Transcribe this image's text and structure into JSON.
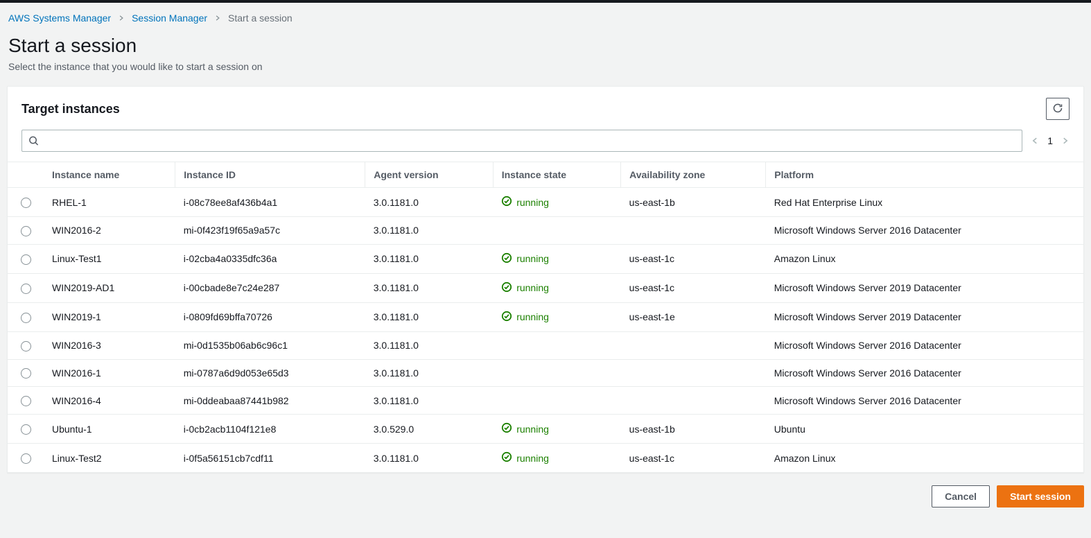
{
  "breadcrumb": {
    "items": [
      {
        "label": "AWS Systems Manager",
        "href": "#"
      },
      {
        "label": "Session Manager",
        "href": "#"
      }
    ],
    "current": "Start a session"
  },
  "header": {
    "title": "Start a session",
    "subtitle": "Select the instance that you would like to start a session on"
  },
  "panel": {
    "title": "Target instances",
    "search_placeholder": "",
    "page": "1"
  },
  "columns": {
    "instance_name": "Instance name",
    "instance_id": "Instance ID",
    "agent_version": "Agent version",
    "instance_state": "Instance state",
    "availability_zone": "Availability zone",
    "platform": "Platform"
  },
  "state_label": "running",
  "rows": [
    {
      "name": "RHEL-1",
      "id": "i-08c78ee8af436b4a1",
      "agent": "3.0.1181.0",
      "state": "running",
      "az": "us-east-1b",
      "platform": "Red Hat Enterprise Linux"
    },
    {
      "name": "WIN2016-2",
      "id": "mi-0f423f19f65a9a57c",
      "agent": "3.0.1181.0",
      "state": "",
      "az": "",
      "platform": "Microsoft Windows Server 2016 Datacenter"
    },
    {
      "name": "Linux-Test1",
      "id": "i-02cba4a0335dfc36a",
      "agent": "3.0.1181.0",
      "state": "running",
      "az": "us-east-1c",
      "platform": "Amazon Linux"
    },
    {
      "name": "WIN2019-AD1",
      "id": "i-00cbade8e7c24e287",
      "agent": "3.0.1181.0",
      "state": "running",
      "az": "us-east-1c",
      "platform": "Microsoft Windows Server 2019 Datacenter"
    },
    {
      "name": "WIN2019-1",
      "id": "i-0809fd69bffa70726",
      "agent": "3.0.1181.0",
      "state": "running",
      "az": "us-east-1e",
      "platform": "Microsoft Windows Server 2019 Datacenter"
    },
    {
      "name": "WIN2016-3",
      "id": "mi-0d1535b06ab6c96c1",
      "agent": "3.0.1181.0",
      "state": "",
      "az": "",
      "platform": "Microsoft Windows Server 2016 Datacenter"
    },
    {
      "name": "WIN2016-1",
      "id": "mi-0787a6d9d053e65d3",
      "agent": "3.0.1181.0",
      "state": "",
      "az": "",
      "platform": "Microsoft Windows Server 2016 Datacenter"
    },
    {
      "name": "WIN2016-4",
      "id": "mi-0ddeabaa87441b982",
      "agent": "3.0.1181.0",
      "state": "",
      "az": "",
      "platform": "Microsoft Windows Server 2016 Datacenter"
    },
    {
      "name": "Ubuntu-1",
      "id": "i-0cb2acb1104f121e8",
      "agent": "3.0.529.0",
      "state": "running",
      "az": "us-east-1b",
      "platform": "Ubuntu"
    },
    {
      "name": "Linux-Test2",
      "id": "i-0f5a56151cb7cdf11",
      "agent": "3.0.1181.0",
      "state": "running",
      "az": "us-east-1c",
      "platform": "Amazon Linux"
    }
  ],
  "footer": {
    "cancel": "Cancel",
    "start": "Start session"
  }
}
